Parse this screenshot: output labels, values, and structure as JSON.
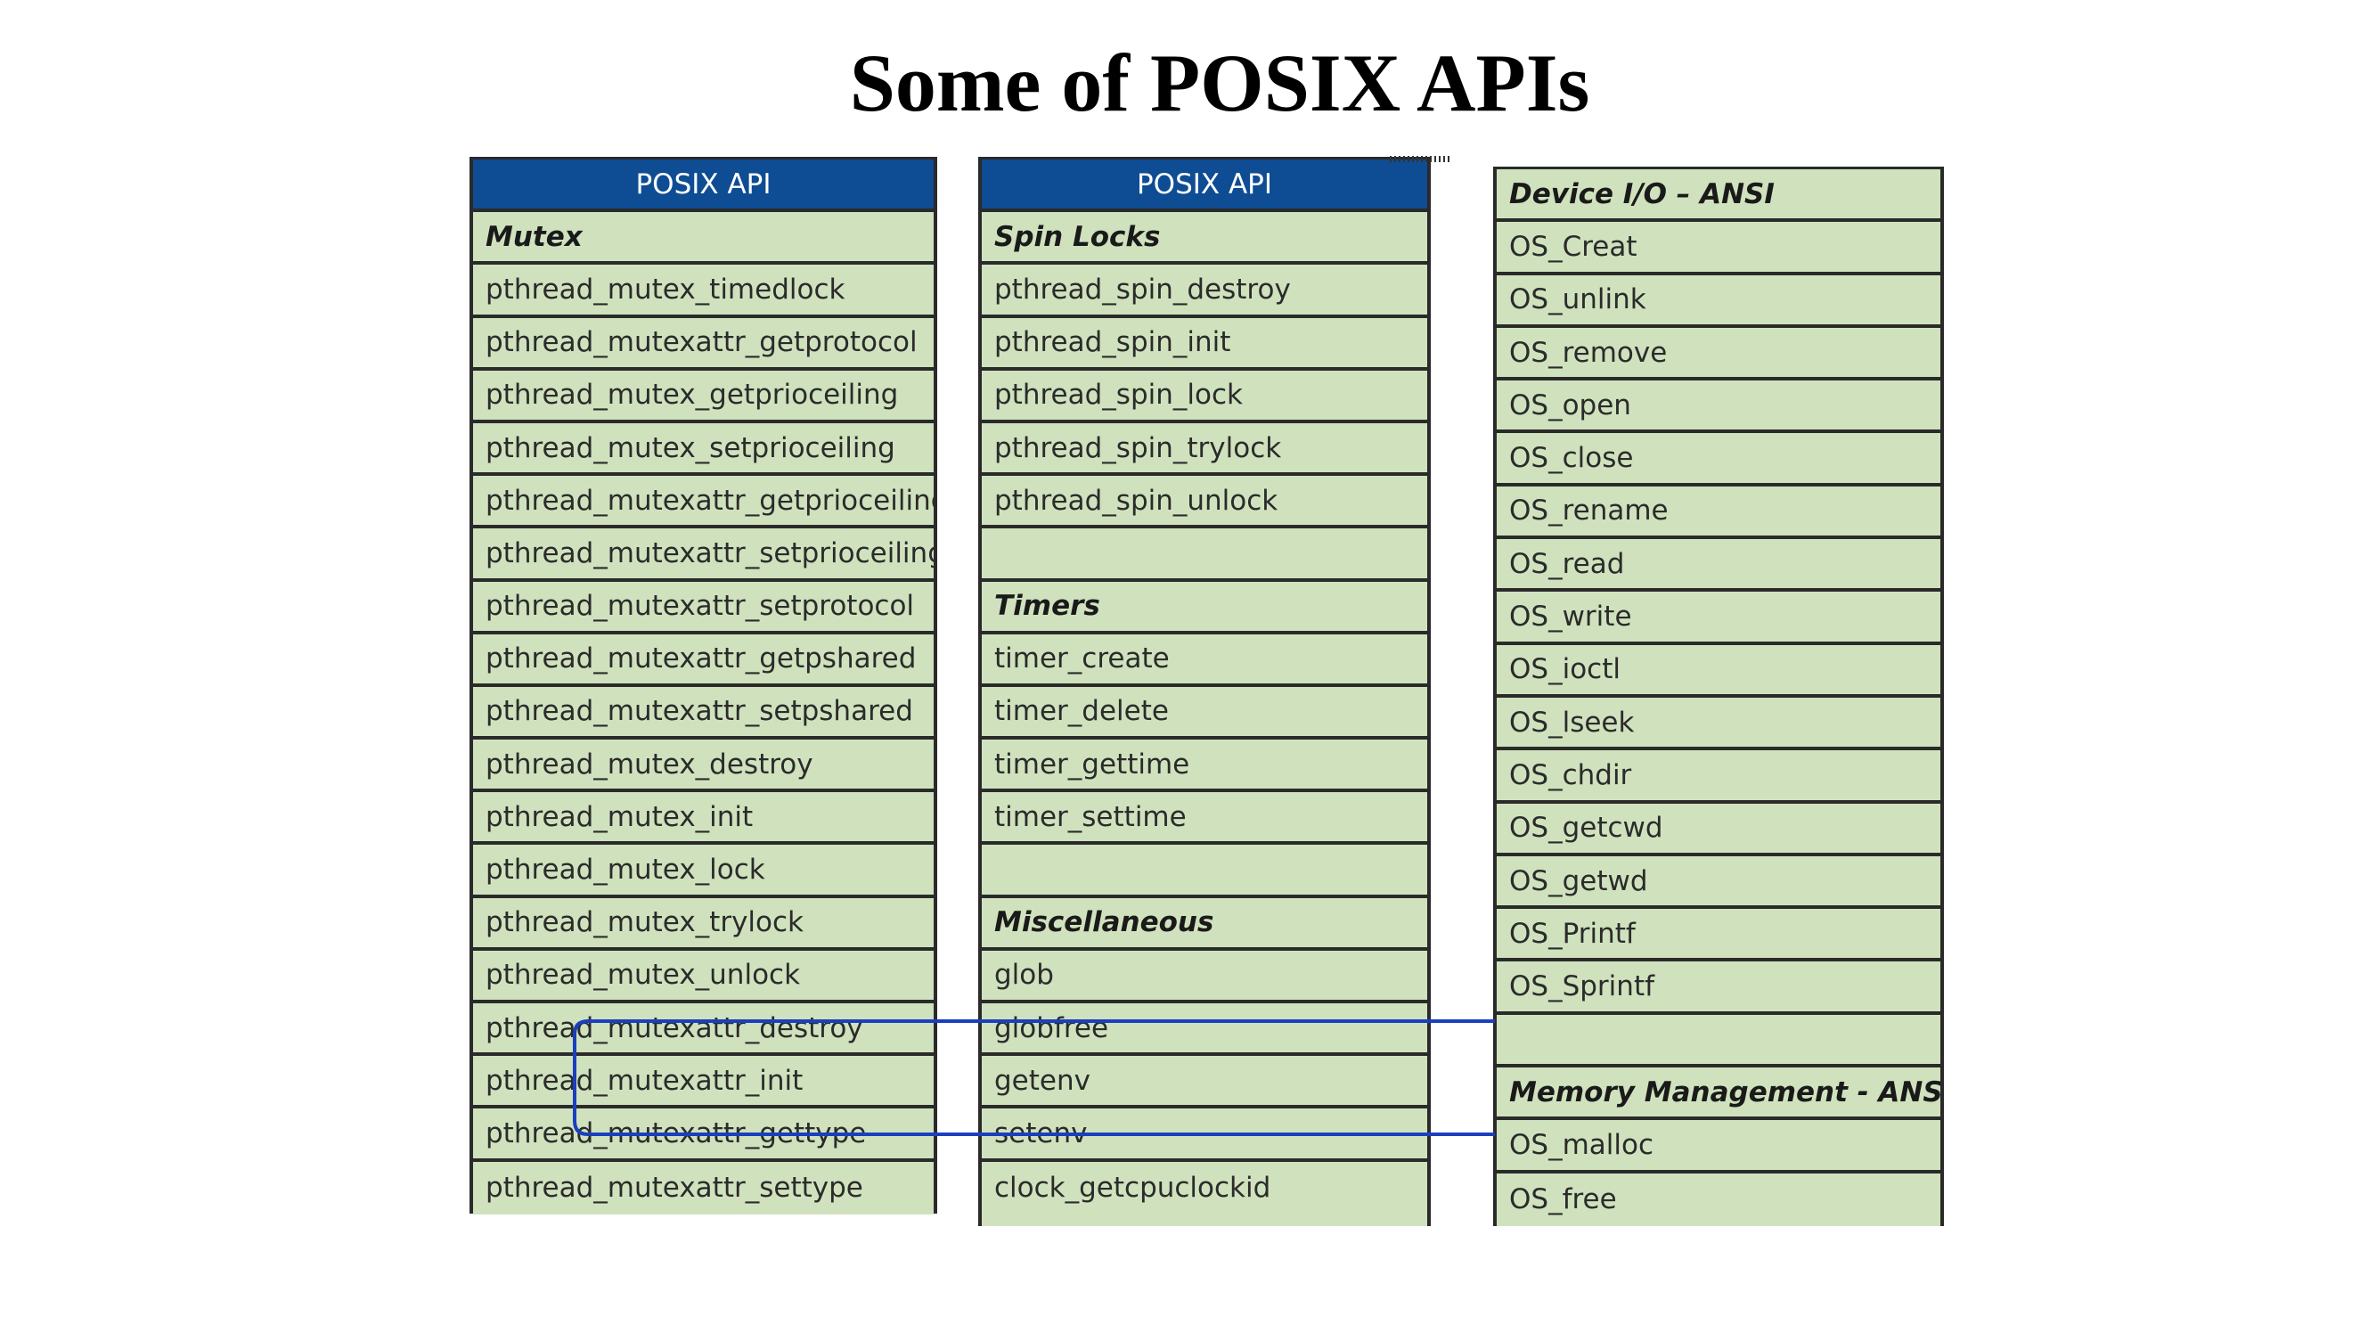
{
  "title": "Some of POSIX APIs",
  "colors": {
    "header_bg": "#0e4c93",
    "row_bg": "#cfe2bd",
    "connector": "#1a3fbf"
  },
  "tables": [
    {
      "header": "POSIX API",
      "rows": [
        {
          "text": "Mutex",
          "type": "section"
        },
        {
          "text": "pthread_mutex_timedlock"
        },
        {
          "text": "pthread_mutexattr_getprotocol"
        },
        {
          "text": "pthread_mutex_getprioceiling"
        },
        {
          "text": "pthread_mutex_setprioceiling"
        },
        {
          "text": "pthread_mutexattr_getprioceiling"
        },
        {
          "text": "pthread_mutexattr_setprioceiling"
        },
        {
          "text": "pthread_mutexattr_setprotocol"
        },
        {
          "text": "pthread_mutexattr_getpshared"
        },
        {
          "text": "pthread_mutexattr_setpshared"
        },
        {
          "text": "pthread_mutex_destroy"
        },
        {
          "text": "pthread_mutex_init"
        },
        {
          "text": "pthread_mutex_lock"
        },
        {
          "text": "pthread_mutex_trylock"
        },
        {
          "text": "pthread_mutex_unlock"
        },
        {
          "text": "pthread_mutexattr_destroy"
        },
        {
          "text": "pthread_mutexattr_init"
        },
        {
          "text": "pthread_mutexattr_gettype"
        },
        {
          "text": "pthread_mutexattr_settype"
        }
      ]
    },
    {
      "header": "POSIX API",
      "rows": [
        {
          "text": "Spin Locks",
          "type": "section"
        },
        {
          "text": "pthread_spin_destroy"
        },
        {
          "text": "pthread_spin_init"
        },
        {
          "text": "pthread_spin_lock"
        },
        {
          "text": "pthread_spin_trylock"
        },
        {
          "text": "pthread_spin_unlock"
        },
        {
          "text": ""
        },
        {
          "text": "Timers",
          "type": "section"
        },
        {
          "text": "timer_create"
        },
        {
          "text": "timer_delete"
        },
        {
          "text": "timer_gettime"
        },
        {
          "text": "timer_settime"
        },
        {
          "text": ""
        },
        {
          "text": "Miscellaneous",
          "type": "section"
        },
        {
          "text": "glob"
        },
        {
          "text": "globfree"
        },
        {
          "text": "getenv"
        },
        {
          "text": "setenv"
        },
        {
          "text": "clock_getcpuclockid"
        }
      ]
    },
    {
      "header": null,
      "rows": [
        {
          "text": "Device I/O – ANSI",
          "type": "section"
        },
        {
          "text": "OS_Creat"
        },
        {
          "text": "OS_unlink"
        },
        {
          "text": "OS_remove"
        },
        {
          "text": "OS_open"
        },
        {
          "text": "OS_close"
        },
        {
          "text": "OS_rename"
        },
        {
          "text": "OS_read"
        },
        {
          "text": "OS_write"
        },
        {
          "text": "OS_ioctl"
        },
        {
          "text": "OS_lseek"
        },
        {
          "text": "OS_chdir"
        },
        {
          "text": "OS_getcwd"
        },
        {
          "text": "OS_getwd"
        },
        {
          "text": "OS_Printf"
        },
        {
          "text": "OS_Sprintf"
        },
        {
          "text": ""
        },
        {
          "text": "Memory Management - ANSI",
          "type": "section"
        },
        {
          "text": "OS_malloc"
        },
        {
          "text": "OS_free"
        }
      ]
    }
  ]
}
